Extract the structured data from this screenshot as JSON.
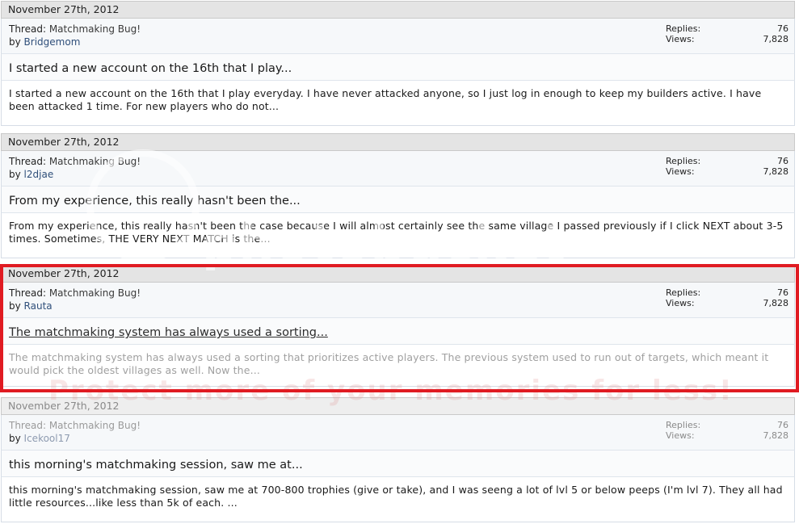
{
  "posts": [
    {
      "date": "November 27th, 2012",
      "thread_prefix": "Thread: ",
      "thread_title": "Matchmaking Bug!",
      "by_prefix": "by ",
      "author": "Bridgemom",
      "replies_label": "Replies:",
      "replies": "76",
      "views_label": "Views:",
      "views": "7,828",
      "post_title": "I started a new account on the 16th that I play...",
      "snippet": "I started a new account on the 16th that I play everyday. I have never attacked anyone, so I just log in enough to keep my builders active. I have been attacked 1 time. For new players who do not..."
    },
    {
      "date": "November 27th, 2012",
      "thread_prefix": "Thread: ",
      "thread_title": "Matchmaking Bug!",
      "by_prefix": "by ",
      "author": "l2djae",
      "replies_label": "Replies:",
      "replies": "76",
      "views_label": "Views:",
      "views": "7,828",
      "post_title": "From my experience, this really hasn't been the...",
      "snippet": "From my experience, this really hasn't been the case because I will almost certainly see the same village I passed previously if I click NEXT about 3-5 times. Sometimes, THE VERY NEXT MATCH is the..."
    },
    {
      "date": "November 27th, 2012",
      "thread_prefix": "Thread: ",
      "thread_title": "Matchmaking Bug!",
      "by_prefix": "by ",
      "author": "Rauta",
      "replies_label": "Replies:",
      "replies": "76",
      "views_label": "Views:",
      "views": "7,828",
      "post_title": "The matchmaking system has always used a sorting...",
      "snippet": "The matchmaking system has always used a sorting that prioritizes active players. The previous system used to run out of targets, which meant it would pick the oldest villages as well. Now the..."
    },
    {
      "date": "November 27th, 2012",
      "thread_prefix": "Thread: ",
      "thread_title": "Matchmaking Bug!",
      "by_prefix": "by ",
      "author": "Icekool17",
      "replies_label": "Replies:",
      "replies": "76",
      "views_label": "Views:",
      "views": "7,828",
      "post_title": "this morning's matchmaking session, saw me at...",
      "snippet": "this morning's matchmaking session, saw me at 700-800 trophies (give or take), and I was seeng a lot of lvl 5 or below peeps (I'm lvl 7). They all had little resources...like less than 5k of each. ..."
    }
  ],
  "watermark": {
    "brand": "photobucket",
    "banner": "Protect more of your memories for less!"
  },
  "colors": {
    "highlight": "#e01b22",
    "date_bar": "#e4e4e4",
    "link": "#2f4f7a"
  }
}
